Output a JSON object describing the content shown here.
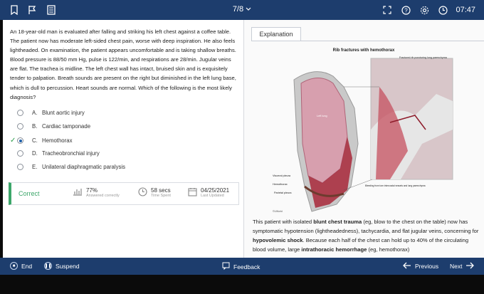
{
  "topbar": {
    "title": "7/8",
    "time": "07:47",
    "icons": [
      "bookmark-icon",
      "flag-icon",
      "notes-icon"
    ],
    "right_icons": [
      "fullscreen-icon",
      "help-icon",
      "settings-icon",
      "clock-icon"
    ]
  },
  "question": {
    "text": "An 18-year-old man is evaluated after falling and striking his left chest against a coffee table. The patient now has moderate left-sided chest pain, worse with deep inspiration. He also feels lightheaded. On examination, the patient appears uncomfortable and is taking shallow breaths. Blood pressure is 88/50 mm Hg, pulse is 122/min, and respirations are 28/min. Jugular veins are flat. The trachea is midline. The left chest wall has intact, bruised skin and is exquisitely tender to palpation. Breath sounds are present on the right but diminished in the left lung base, which is dull to percussion. Heart sounds are normal. Which of the following is the most likely diagnosis?",
    "options": [
      {
        "letter": "A.",
        "label": "Blunt aortic injury"
      },
      {
        "letter": "B.",
        "label": "Cardiac tamponade"
      },
      {
        "letter": "C.",
        "label": "Hemothorax"
      },
      {
        "letter": "D.",
        "label": "Tracheobronchial injury"
      },
      {
        "letter": "E.",
        "label": "Unilateral diaphragmatic paralysis"
      }
    ],
    "selected_index": 2
  },
  "stats": {
    "result": "Correct",
    "percent": "77%",
    "percent_label": "Answered correctly",
    "time": "58 secs",
    "time_label": "Time Spent",
    "date": "04/25/2021",
    "date_label": "Last Updated"
  },
  "explanation": {
    "tab": "Explanation",
    "figure_title": "Rib fractures with hemothorax",
    "figure_labels": {
      "fractured_rib": "Fractured rib puncturing lung parenchyma",
      "left_lung": "Left lung",
      "visceral": "Visceral pleura",
      "hemothorax": "Hemothorax",
      "parietal": "Parietal pleura",
      "bleeding": "Bleeding from torn intercostal vessels and lung parenchyma",
      "source": "©UWorld"
    },
    "p_before": "This patient with isolated ",
    "b1": "blunt chest trauma",
    "p_mid1": " (eg, blow to the chest on the table) now has symptomatic hypotension (lightheadedness), tachycardia, and flat jugular veins, concerning for ",
    "b2": "hypovolemic shock",
    "p_mid2": ". Because each half of the chest can hold up to 40% of the circulating blood volume, large ",
    "b3": "intrathoracic hemorrhage",
    "p_end": " (eg, hemothorax)"
  },
  "bottombar": {
    "end": "End",
    "suspend": "Suspend",
    "feedback": "Feedback",
    "previous": "Previous",
    "next": "Next"
  },
  "colors": {
    "bar": "#1d3d6d",
    "correct": "#3ca66a",
    "accent": "#1d5fa8"
  }
}
